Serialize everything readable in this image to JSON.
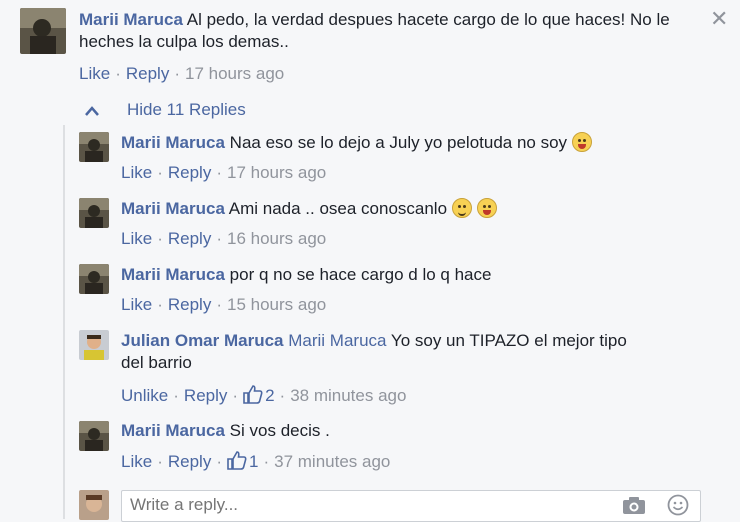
{
  "main_comment": {
    "author": "Marii Maruca",
    "text_line1": "Al pedo, la verdad despues hacete cargo de lo que haces! No le",
    "text_line2": "heches la culpa los demas..",
    "like_label": "Like",
    "reply_label": "Reply",
    "time": "17 hours ago",
    "close_glyph": "✕"
  },
  "hide_replies": {
    "label": "Hide 11 Replies"
  },
  "replies": [
    {
      "author": "Marii Maruca",
      "text": "Naa eso se lo dejo a July yo pelotuda no soy",
      "like_label": "Like",
      "reply_label": "Reply",
      "time": "17 hours ago"
    },
    {
      "author": "Marii Maruca",
      "text": "Ami nada .. osea conoscanlo",
      "like_label": "Like",
      "reply_label": "Reply",
      "time": "16 hours ago"
    },
    {
      "author": "Marii Maruca",
      "text": "por q no se hace cargo d lo q hace",
      "like_label": "Like",
      "reply_label": "Reply",
      "time": "15 hours ago"
    },
    {
      "author": "Julian Omar Maruca",
      "mention": "Marii Maruca",
      "text_line1": "Yo soy un TIPAZO el mejor tipo",
      "text_line2": "del barrio",
      "like_label": "Unlike",
      "reply_label": "Reply",
      "likes": "2",
      "time": "38 minutes ago"
    },
    {
      "author": "Marii Maruca",
      "text": "Si vos decis .",
      "like_label": "Like",
      "reply_label": "Reply",
      "likes": "1",
      "time": "37 minutes ago"
    }
  ],
  "reply_input": {
    "placeholder": "Write a reply..."
  },
  "colors": {
    "name": "#365899",
    "link": "#4b67a1",
    "meta": "#90949c",
    "background": "#f6f7f9"
  },
  "icons": [
    "close-icon",
    "chevron-up-icon",
    "thumbs-up-icon",
    "camera-icon",
    "smiley-icon",
    "smile-emoji",
    "heart-eyes-emoji"
  ]
}
